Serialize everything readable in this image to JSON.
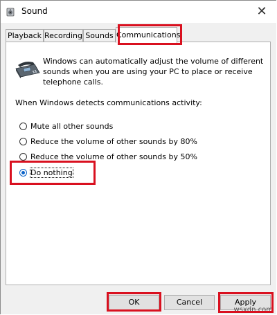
{
  "window": {
    "title": "Sound",
    "close_glyph": "✕"
  },
  "tabs": [
    {
      "label": "Playback"
    },
    {
      "label": "Recording"
    },
    {
      "label": "Sounds"
    },
    {
      "label": "Communications",
      "active": true
    }
  ],
  "communications": {
    "description": "Windows can automatically adjust the volume of different sounds when you are using your PC to place or receive telephone calls.",
    "detect_label": "When Windows detects communications activity:",
    "options": [
      {
        "label": "Mute all other sounds",
        "selected": false
      },
      {
        "label": "Reduce the volume of other sounds by 80%",
        "selected": false
      },
      {
        "label": "Reduce the volume of other sounds by 50%",
        "selected": false
      },
      {
        "label": "Do nothing",
        "selected": true
      }
    ]
  },
  "buttons": {
    "ok": "OK",
    "cancel": "Cancel",
    "apply": "Apply"
  },
  "highlight_color": "#d9101f",
  "accent_color": "#0a63c9",
  "watermark": "wsxdn.com",
  "icons": {
    "app": "speaker-icon",
    "phone": "telephone-icon",
    "close": "close-icon"
  }
}
